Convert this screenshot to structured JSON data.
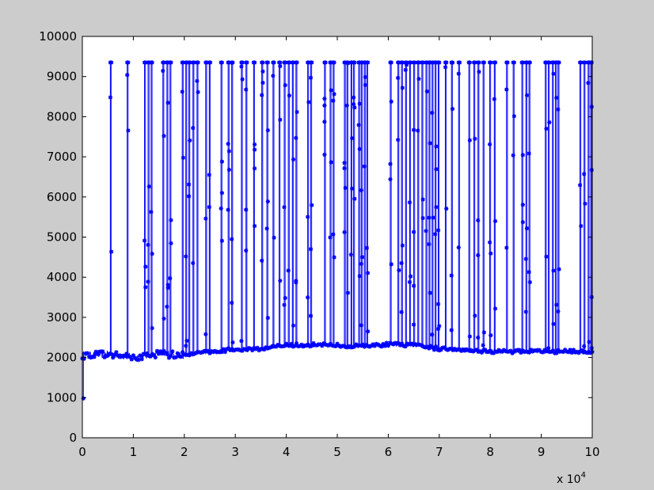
{
  "colors": {
    "figure_bg": "#cccccc",
    "axes_bg": "#ffffff",
    "series": "#0000ff",
    "axis": "#000000"
  },
  "chart_data": {
    "type": "line",
    "title": "",
    "xlabel": "",
    "ylabel": "",
    "x_exponent": {
      "base": "x 10",
      "power": "4"
    },
    "xlim": [
      0,
      10
    ],
    "ylim": [
      0,
      10000
    ],
    "xticks": [
      0,
      1,
      2,
      3,
      4,
      5,
      6,
      7,
      8,
      9,
      10
    ],
    "yticks": [
      0,
      1000,
      2000,
      3000,
      4000,
      5000,
      6000,
      7000,
      8000,
      9000,
      10000
    ],
    "grid": false,
    "legend": "none",
    "marker": "asterisk",
    "baseline": [
      [
        0.0,
        2050
      ],
      [
        0.5,
        2080
      ],
      [
        1.0,
        2000
      ],
      [
        1.5,
        2100
      ],
      [
        2.0,
        2050
      ],
      [
        2.5,
        2150
      ],
      [
        3.0,
        2200
      ],
      [
        3.5,
        2220
      ],
      [
        4.0,
        2300
      ],
      [
        4.5,
        2320
      ],
      [
        5.0,
        2300
      ],
      [
        5.5,
        2280
      ],
      [
        6.0,
        2330
      ],
      [
        6.5,
        2300
      ],
      [
        7.0,
        2220
      ],
      [
        7.5,
        2200
      ],
      [
        8.0,
        2150
      ],
      [
        8.5,
        2150
      ],
      [
        9.0,
        2150
      ],
      [
        9.5,
        2150
      ],
      [
        10.0,
        2150
      ]
    ],
    "spike_peak": 9350,
    "spikes_x": [
      0.55,
      0.88,
      1.22,
      1.29,
      1.35,
      1.58,
      1.66,
      1.72,
      1.96,
      2.03,
      2.09,
      2.17,
      2.25,
      2.42,
      2.49,
      2.72,
      2.86,
      2.93,
      3.12,
      3.21,
      3.36,
      3.52,
      3.62,
      3.74,
      3.86,
      3.96,
      4.04,
      4.12,
      4.19,
      4.42,
      4.48,
      4.75,
      4.86,
      4.92,
      5.14,
      5.19,
      5.27,
      5.32,
      5.42,
      5.47,
      5.53,
      5.58,
      6.04,
      6.19,
      6.26,
      6.34,
      6.42,
      6.5,
      6.58,
      6.66,
      6.74,
      6.8,
      6.86,
      6.92,
      6.98,
      7.12,
      7.24,
      7.38,
      7.58,
      7.68,
      7.76,
      7.86,
      7.99,
      8.08,
      8.32,
      8.45,
      8.62,
      8.7,
      8.76,
      9.08,
      9.14,
      9.22,
      9.28,
      9.33,
      9.76,
      9.84,
      9.92,
      9.97
    ],
    "start_outlier": [
      0.02,
      980
    ]
  }
}
